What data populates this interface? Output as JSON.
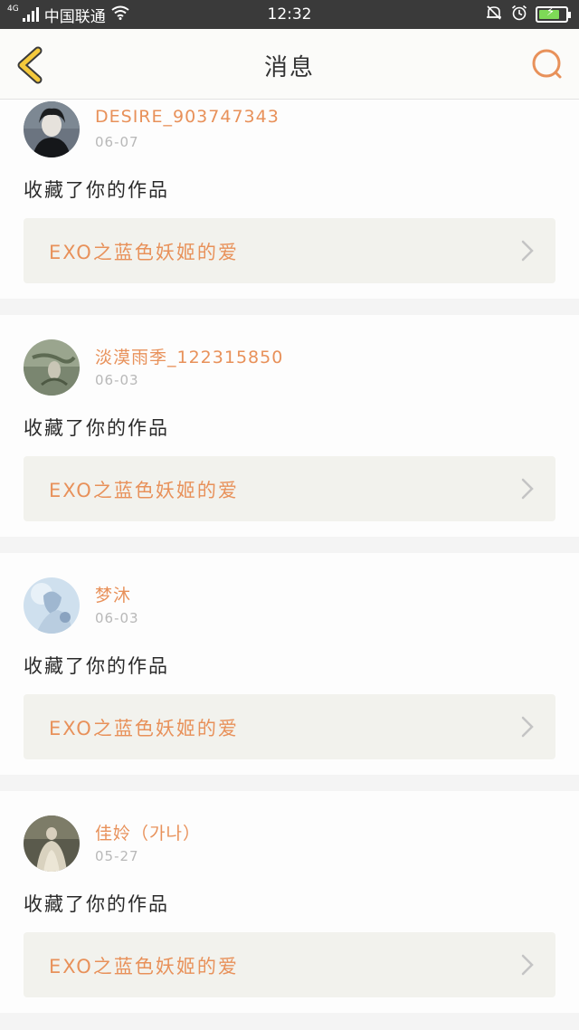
{
  "status_bar": {
    "network": "4G",
    "carrier": "中国联通",
    "time": "12:32",
    "battery_level": 0.8
  },
  "header": {
    "title": "消息"
  },
  "notifications": [
    {
      "username": "DESIRE_903747343",
      "date": "06-07",
      "action": "收藏了你的作品",
      "work_title": "EXO之蓝色妖姬的爱"
    },
    {
      "username": "淡漠雨季_122315850",
      "date": "06-03",
      "action": "收藏了你的作品",
      "work_title": "EXO之蓝色妖姬的爱"
    },
    {
      "username": "梦沐",
      "date": "06-03",
      "action": "收藏了你的作品",
      "work_title": "EXO之蓝色妖姬的爱"
    },
    {
      "username": "佳姈（가나）",
      "date": "05-27",
      "action": "收藏了你的作品",
      "work_title": "EXO之蓝色妖姬的爱"
    }
  ],
  "colors": {
    "accent": "#e8915a",
    "back_icon": "#f4c93c",
    "status_bar_bg": "#3a3a3a"
  },
  "icons": {
    "back": "back-chevron-icon",
    "search": "search-icon",
    "chevron": "chevron-right-icon"
  }
}
